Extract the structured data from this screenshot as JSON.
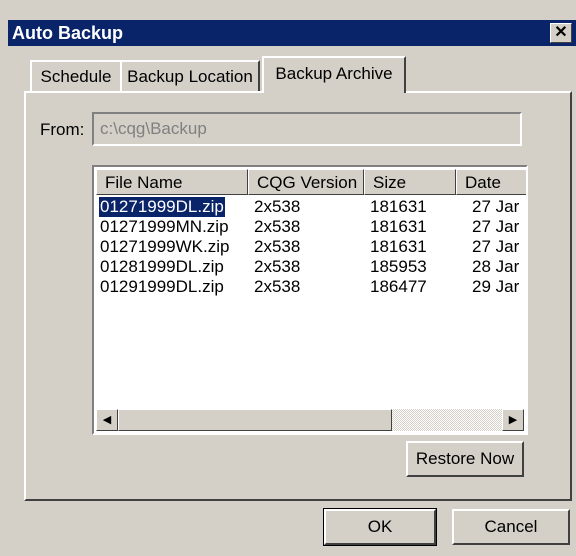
{
  "window": {
    "title": "Auto Backup",
    "close_glyph": "✕"
  },
  "tabs": [
    {
      "label": "Schedule",
      "active": false
    },
    {
      "label": "Backup Location",
      "active": false
    },
    {
      "label": "Backup Archive",
      "active": true
    }
  ],
  "from": {
    "label": "From:",
    "value": "c:\\cqg\\Backup"
  },
  "file_list": {
    "columns": [
      "File Name",
      "CQG Version",
      "Size",
      "Date"
    ],
    "rows": [
      {
        "name": "01271999DL.zip",
        "version": "2x538",
        "size": "181631",
        "date": "27 Jar",
        "selected": true
      },
      {
        "name": "01271999MN.zip",
        "version": "2x538",
        "size": "181631",
        "date": "27 Jar",
        "selected": false
      },
      {
        "name": "01271999WK.zip",
        "version": "2x538",
        "size": "181631",
        "date": "27 Jar",
        "selected": false
      },
      {
        "name": "01281999DL.zip",
        "version": "2x538",
        "size": "185953",
        "date": "28 Jar",
        "selected": false
      },
      {
        "name": "01291999DL.zip",
        "version": "2x538",
        "size": "186477",
        "date": "29 Jar",
        "selected": false
      }
    ]
  },
  "scrollbar": {
    "left_arrow": "◀",
    "right_arrow": "▶"
  },
  "buttons": {
    "restore": "Restore Now",
    "ok": "OK",
    "cancel": "Cancel"
  }
}
